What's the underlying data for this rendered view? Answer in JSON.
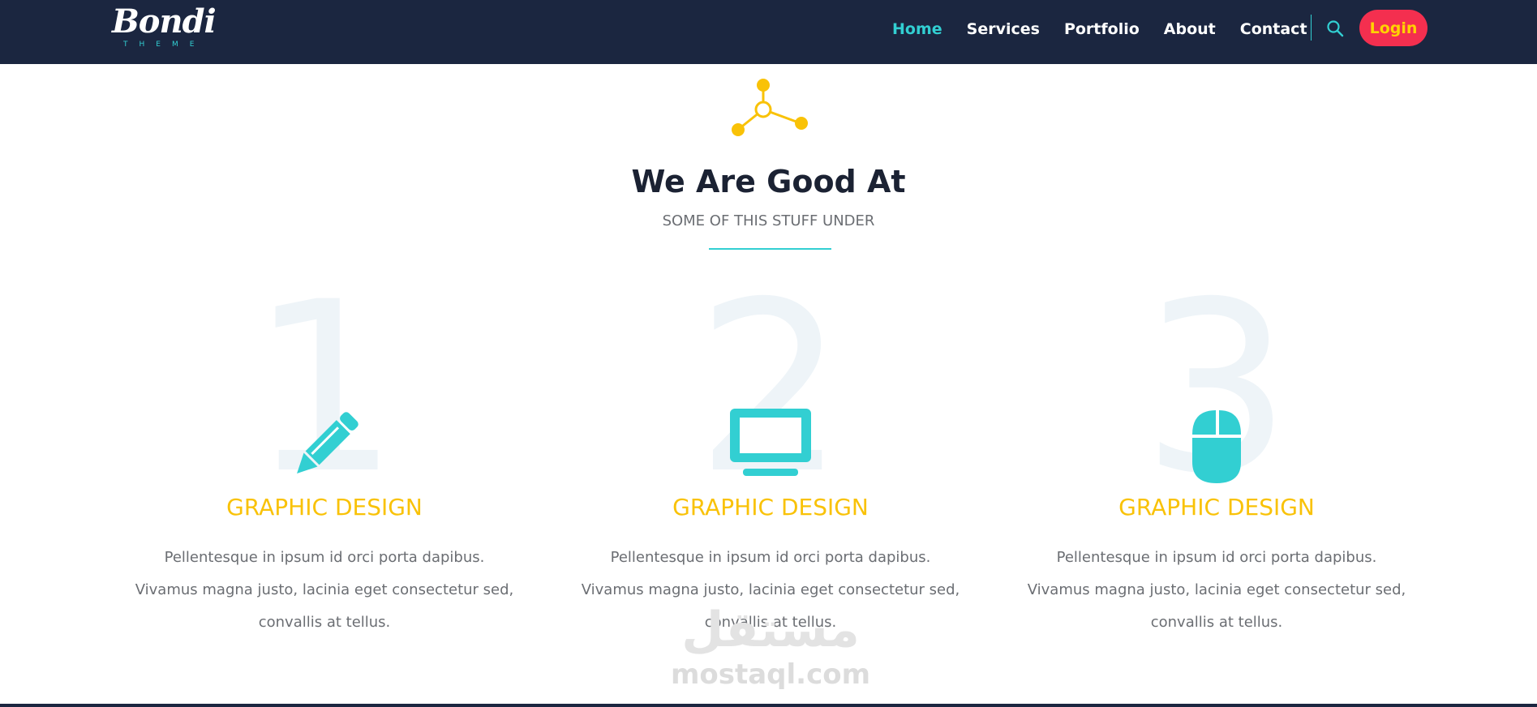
{
  "navbar": {
    "logo_text": "Bondi",
    "logo_sub": "THEME",
    "links": [
      {
        "label": "Home",
        "active": true
      },
      {
        "label": "Services",
        "active": false
      },
      {
        "label": "Portfolio",
        "active": false
      },
      {
        "label": "About",
        "active": false
      },
      {
        "label": "Contact",
        "active": false
      }
    ],
    "search_icon": "search-icon",
    "login_label": "Login"
  },
  "section": {
    "icon": "network-nodes-icon",
    "title": "We Are Good At",
    "subtitle": "SOME OF THIS STUFF UNDER"
  },
  "features": [
    {
      "number": "1",
      "icon": "pencil-icon",
      "title": "GRAPHIC DESIGN",
      "text": "Pellentesque in ipsum id orci porta dapibus. Vivamus magna justo, lacinia eget consectetur sed, convallis at tellus."
    },
    {
      "number": "2",
      "icon": "monitor-icon",
      "title": "GRAPHIC DESIGN",
      "text": "Pellentesque in ipsum id orci porta dapibus. Vivamus magna justo, lacinia eget consectetur sed, convallis at tellus."
    },
    {
      "number": "3",
      "icon": "mouse-icon",
      "title": "GRAPHIC DESIGN",
      "text": "Pellentesque in ipsum id orci porta dapibus. Vivamus magna justo, lacinia eget consectetur sed, convallis at tellus."
    }
  ],
  "watermark": {
    "arabic": "مستقل",
    "latin": "mostaql.com"
  },
  "colors": {
    "navbar_bg": "#1b2640",
    "accent_teal": "#32cfd2",
    "accent_yellow": "#f9c207",
    "login_bg": "#f42f4f",
    "login_text": "#ffd200"
  }
}
